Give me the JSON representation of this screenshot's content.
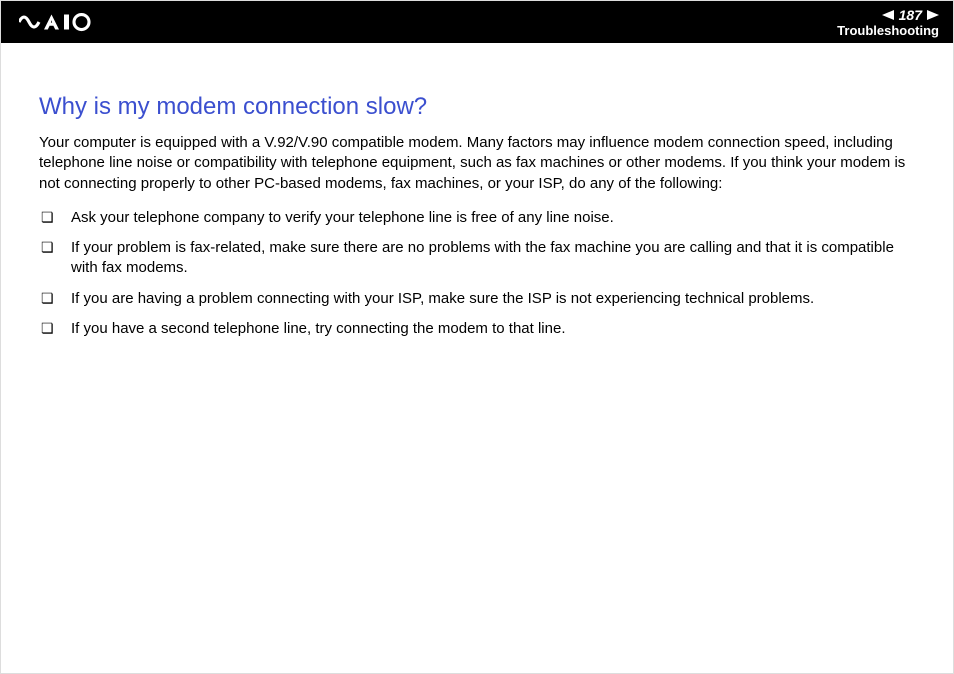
{
  "header": {
    "page_number": "187",
    "section": "Troubleshooting"
  },
  "content": {
    "title": "Why is my modem connection slow?",
    "intro": "Your computer is equipped with a V.92/V.90 compatible modem. Many factors may influence modem connection speed, including telephone line noise or compatibility with telephone equipment, such as fax machines or other modems. If you think your modem is not connecting properly to other PC-based modems, fax machines, or your ISP, do any of the following:",
    "bullets": [
      "Ask your telephone company to verify your telephone line is free of any line noise.",
      "If your problem is fax-related, make sure there are no problems with the fax machine you are calling and that it is compatible with fax modems.",
      "If you are having a problem connecting with your ISP, make sure the ISP is not experiencing technical problems.",
      "If you have a second telephone line, try connecting the modem to that line."
    ]
  }
}
